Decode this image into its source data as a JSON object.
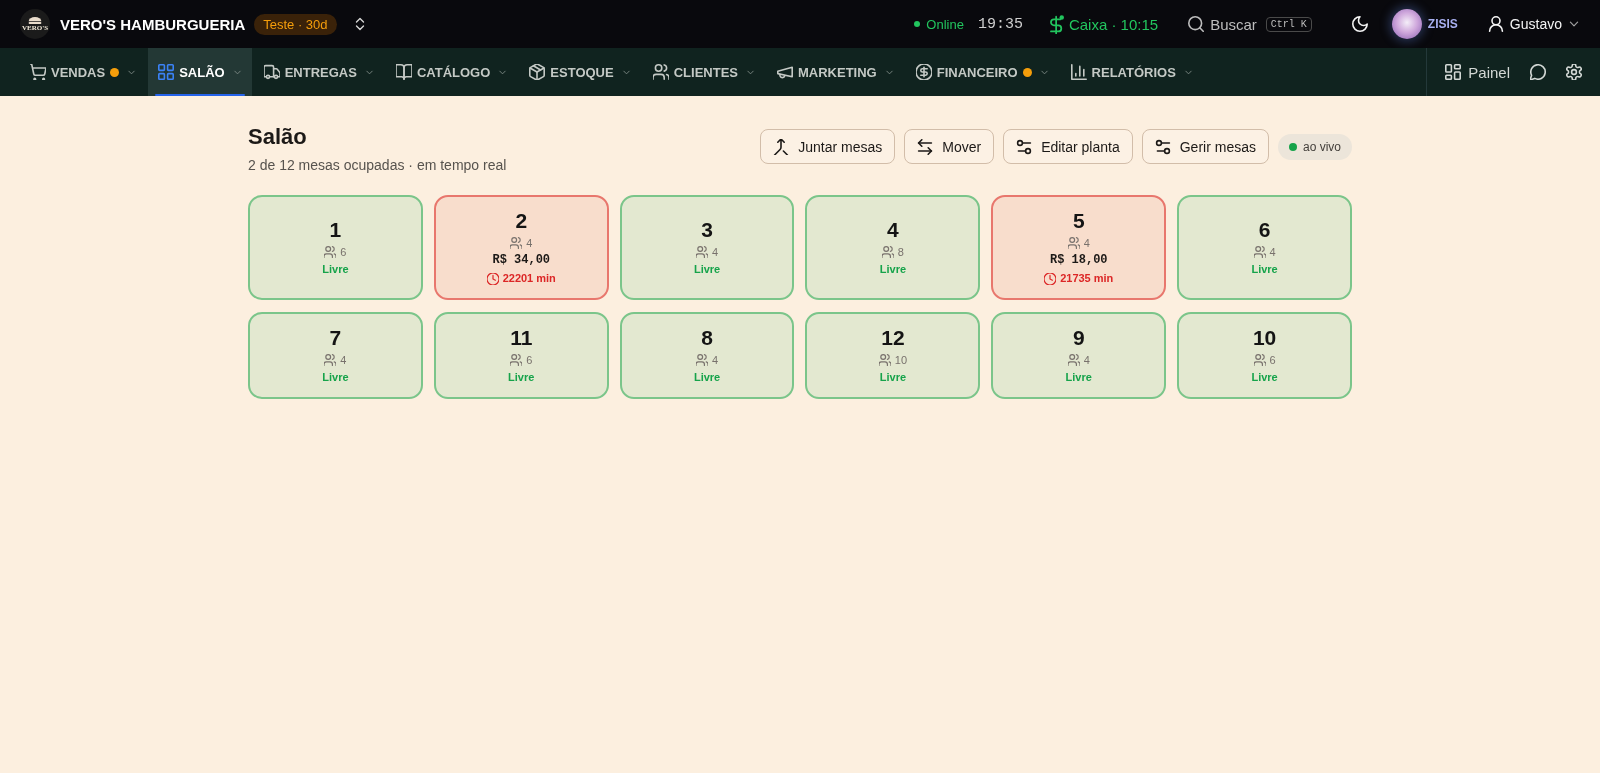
{
  "brand": {
    "logo_text": "VERO'S",
    "name": "VERO'S HAMBURGUERIA",
    "badge": "Teste · 30d"
  },
  "status": {
    "connection": "Online",
    "time": "19:35",
    "cash": "Caixa · 10:15"
  },
  "search": {
    "label": "Buscar",
    "shortcut": "Ctrl K"
  },
  "assistant": {
    "name": "ZISIS"
  },
  "user": {
    "name": "Gustavo"
  },
  "nav": [
    {
      "label": "VENDAS",
      "alert": true,
      "selected": false
    },
    {
      "label": "SALÃO",
      "alert": false,
      "selected": true
    },
    {
      "label": "ENTREGAS",
      "alert": false,
      "selected": false
    },
    {
      "label": "CATÁLOGO",
      "alert": false,
      "selected": false
    },
    {
      "label": "ESTOQUE",
      "alert": false,
      "selected": false
    },
    {
      "label": "CLIENTES",
      "alert": false,
      "selected": false
    },
    {
      "label": "MARKETING",
      "alert": false,
      "selected": false
    },
    {
      "label": "FINANCEIRO",
      "alert": true,
      "selected": false
    },
    {
      "label": "RELATÓRIOS",
      "alert": false,
      "selected": false
    }
  ],
  "nav_right": {
    "panel": "Painel"
  },
  "page": {
    "title": "Salão",
    "subtitle": "2 de 12 mesas ocupadas · em tempo real",
    "actions": [
      "Juntar mesas",
      "Mover",
      "Editar planta",
      "Gerir mesas"
    ],
    "live": "ao vivo"
  },
  "tables": [
    {
      "number": "1",
      "seats": "6",
      "kind": "free",
      "status": "Livre"
    },
    {
      "number": "2",
      "seats": "4",
      "kind": "occupied",
      "total": "R$ 34,00",
      "elapsed": "22201 min"
    },
    {
      "number": "3",
      "seats": "4",
      "kind": "free",
      "status": "Livre"
    },
    {
      "number": "4",
      "seats": "8",
      "kind": "free",
      "status": "Livre"
    },
    {
      "number": "5",
      "seats": "4",
      "kind": "occupied",
      "total": "R$ 18,00",
      "elapsed": "21735 min"
    },
    {
      "number": "6",
      "seats": "4",
      "kind": "free",
      "status": "Livre"
    },
    {
      "number": "7",
      "seats": "4",
      "kind": "free",
      "status": "Livre"
    },
    {
      "number": "11",
      "seats": "6",
      "kind": "free",
      "status": "Livre"
    },
    {
      "number": "8",
      "seats": "4",
      "kind": "free",
      "status": "Livre"
    },
    {
      "number": "12",
      "seats": "10",
      "kind": "free",
      "status": "Livre"
    },
    {
      "number": "9",
      "seats": "4",
      "kind": "free",
      "status": "Livre"
    },
    {
      "number": "10",
      "seats": "6",
      "kind": "free",
      "status": "Livre"
    }
  ]
}
